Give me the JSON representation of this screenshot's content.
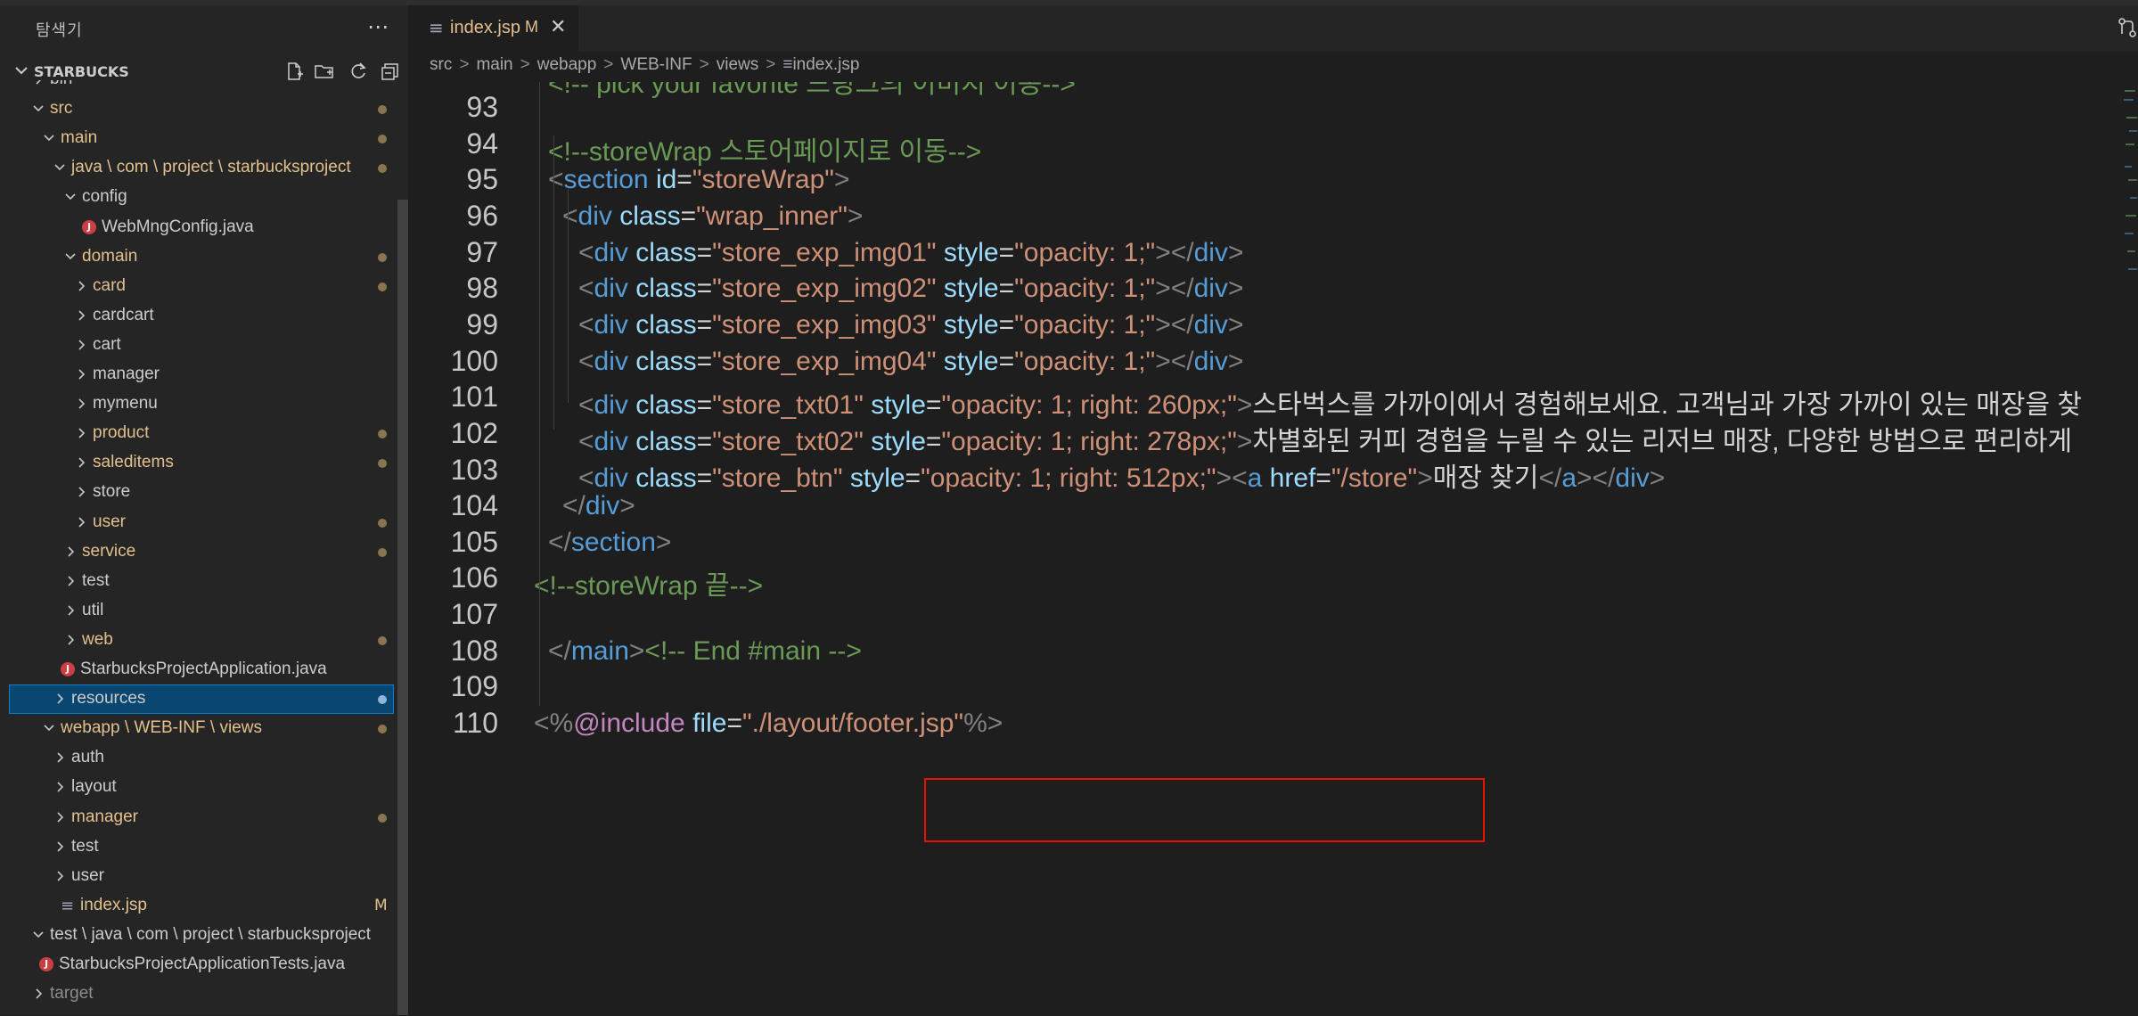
{
  "explorer": {
    "title": "탐색기",
    "more_icon": "ellipsis-icon",
    "workspace": "STARBUCKS",
    "actions": [
      "new-file-icon",
      "new-folder-icon",
      "refresh-icon",
      "collapse-all-icon"
    ]
  },
  "tree": [
    {
      "label": "bin",
      "kind": "folder",
      "expanded": false,
      "color": "default",
      "badge": ""
    },
    {
      "label": "src",
      "kind": "folder",
      "expanded": true,
      "color": "modified",
      "badge": "dot"
    },
    {
      "label": "main",
      "kind": "folder",
      "expanded": true,
      "color": "modified",
      "badge": "dot"
    },
    {
      "label": "java \\ com \\ project \\ starbucksproject",
      "kind": "folder",
      "expanded": true,
      "color": "modified",
      "badge": "dot"
    },
    {
      "label": "config",
      "kind": "folder",
      "expanded": true,
      "color": "default",
      "badge": ""
    },
    {
      "label": "WebMngConfig.java",
      "kind": "java",
      "color": "default",
      "badge": ""
    },
    {
      "label": "domain",
      "kind": "folder",
      "expanded": true,
      "color": "modified",
      "badge": "dot"
    },
    {
      "label": "card",
      "kind": "folder",
      "expanded": false,
      "color": "modified",
      "badge": "dot"
    },
    {
      "label": "cardcart",
      "kind": "folder",
      "expanded": false,
      "color": "default",
      "badge": ""
    },
    {
      "label": "cart",
      "kind": "folder",
      "expanded": false,
      "color": "default",
      "badge": ""
    },
    {
      "label": "manager",
      "kind": "folder",
      "expanded": false,
      "color": "default",
      "badge": ""
    },
    {
      "label": "mymenu",
      "kind": "folder",
      "expanded": false,
      "color": "default",
      "badge": ""
    },
    {
      "label": "product",
      "kind": "folder",
      "expanded": false,
      "color": "modified",
      "badge": "dot"
    },
    {
      "label": "saleditems",
      "kind": "folder",
      "expanded": false,
      "color": "modified",
      "badge": "dot"
    },
    {
      "label": "store",
      "kind": "folder",
      "expanded": false,
      "color": "default",
      "badge": ""
    },
    {
      "label": "user",
      "kind": "folder",
      "expanded": false,
      "color": "modified",
      "badge": "dot"
    },
    {
      "label": "service",
      "kind": "folder",
      "expanded": false,
      "color": "modified",
      "badge": "dot"
    },
    {
      "label": "test",
      "kind": "folder",
      "expanded": false,
      "color": "default",
      "badge": ""
    },
    {
      "label": "util",
      "kind": "folder",
      "expanded": false,
      "color": "default",
      "badge": ""
    },
    {
      "label": "web",
      "kind": "folder",
      "expanded": false,
      "color": "modified",
      "badge": "dot"
    },
    {
      "label": "StarbucksProjectApplication.java",
      "kind": "java",
      "color": "default",
      "badge": ""
    },
    {
      "label": "resources",
      "kind": "folder",
      "expanded": false,
      "color": "default",
      "badge": "dot",
      "selected": true
    },
    {
      "label": "webapp \\ WEB-INF \\ views",
      "kind": "folder",
      "expanded": true,
      "color": "modified",
      "badge": "dot"
    },
    {
      "label": "auth",
      "kind": "folder",
      "expanded": false,
      "color": "default",
      "badge": ""
    },
    {
      "label": "layout",
      "kind": "folder",
      "expanded": false,
      "color": "default",
      "badge": ""
    },
    {
      "label": "manager",
      "kind": "folder",
      "expanded": false,
      "color": "modified",
      "badge": "dot"
    },
    {
      "label": "test",
      "kind": "folder",
      "expanded": false,
      "color": "default",
      "badge": ""
    },
    {
      "label": "user",
      "kind": "folder",
      "expanded": false,
      "color": "default",
      "badge": ""
    },
    {
      "label": "index.jsp",
      "kind": "jsp",
      "color": "modified",
      "badge": "M"
    },
    {
      "label": "test \\ java \\ com \\ project \\ starbucksproject",
      "kind": "folder",
      "expanded": true,
      "color": "default",
      "badge": ""
    },
    {
      "label": "StarbucksProjectApplicationTests.java",
      "kind": "java",
      "color": "default",
      "badge": ""
    },
    {
      "label": "target",
      "kind": "folder",
      "expanded": false,
      "color": "gray",
      "badge": ""
    }
  ],
  "tab": {
    "icon": "file-lines-icon",
    "label": "index.jsp",
    "modified": "M",
    "close_icon": "close-icon"
  },
  "topright_icon": "source-control-icon",
  "breadcrumb": [
    "src",
    "main",
    "webapp",
    "WEB-INF",
    "views",
    "index.jsp"
  ],
  "code": [
    {
      "n": "93",
      "tokens": []
    },
    {
      "n": "94",
      "tokens": [
        [
          "com",
          "<!--storeWrap 스토어페이지로 이동-->"
        ]
      ]
    },
    {
      "n": "95",
      "tokens": [
        [
          "tag",
          "<"
        ],
        [
          "name",
          "section"
        ],
        [
          "eq",
          " "
        ],
        [
          "attr",
          "id"
        ],
        [
          "eq",
          "="
        ],
        [
          "str",
          "\"storeWrap\""
        ],
        [
          "tag",
          ">"
        ]
      ]
    },
    {
      "n": "96",
      "tokens": [
        [
          "tag",
          "<"
        ],
        [
          "name",
          "div"
        ],
        [
          "eq",
          " "
        ],
        [
          "attr",
          "class"
        ],
        [
          "eq",
          "="
        ],
        [
          "str",
          "\"wrap_inner\""
        ],
        [
          "tag",
          ">"
        ]
      ]
    },
    {
      "n": "97",
      "tokens": [
        [
          "tag",
          "<"
        ],
        [
          "name",
          "div"
        ],
        [
          "eq",
          " "
        ],
        [
          "attr",
          "class"
        ],
        [
          "eq",
          "="
        ],
        [
          "str",
          "\"store_exp_img01\""
        ],
        [
          "eq",
          " "
        ],
        [
          "attr",
          "style"
        ],
        [
          "eq",
          "="
        ],
        [
          "str",
          "\"opacity: 1;\""
        ],
        [
          "tag",
          "></"
        ],
        [
          "name",
          "div"
        ],
        [
          "tag",
          ">"
        ]
      ]
    },
    {
      "n": "98",
      "tokens": [
        [
          "tag",
          "<"
        ],
        [
          "name",
          "div"
        ],
        [
          "eq",
          " "
        ],
        [
          "attr",
          "class"
        ],
        [
          "eq",
          "="
        ],
        [
          "str",
          "\"store_exp_img02\""
        ],
        [
          "eq",
          " "
        ],
        [
          "attr",
          "style"
        ],
        [
          "eq",
          "="
        ],
        [
          "str",
          "\"opacity: 1;\""
        ],
        [
          "tag",
          "></"
        ],
        [
          "name",
          "div"
        ],
        [
          "tag",
          ">"
        ]
      ]
    },
    {
      "n": "99",
      "tokens": [
        [
          "tag",
          "<"
        ],
        [
          "name",
          "div"
        ],
        [
          "eq",
          " "
        ],
        [
          "attr",
          "class"
        ],
        [
          "eq",
          "="
        ],
        [
          "str",
          "\"store_exp_img03\""
        ],
        [
          "eq",
          " "
        ],
        [
          "attr",
          "style"
        ],
        [
          "eq",
          "="
        ],
        [
          "str",
          "\"opacity: 1;\""
        ],
        [
          "tag",
          "></"
        ],
        [
          "name",
          "div"
        ],
        [
          "tag",
          ">"
        ]
      ]
    },
    {
      "n": "100",
      "tokens": [
        [
          "tag",
          "<"
        ],
        [
          "name",
          "div"
        ],
        [
          "eq",
          " "
        ],
        [
          "attr",
          "class"
        ],
        [
          "eq",
          "="
        ],
        [
          "str",
          "\"store_exp_img04\""
        ],
        [
          "eq",
          " "
        ],
        [
          "attr",
          "style"
        ],
        [
          "eq",
          "="
        ],
        [
          "str",
          "\"opacity: 1;\""
        ],
        [
          "tag",
          "></"
        ],
        [
          "name",
          "div"
        ],
        [
          "tag",
          ">"
        ]
      ]
    },
    {
      "n": "101",
      "tokens": [
        [
          "tag",
          "<"
        ],
        [
          "name",
          "div"
        ],
        [
          "eq",
          " "
        ],
        [
          "attr",
          "class"
        ],
        [
          "eq",
          "="
        ],
        [
          "str",
          "\"store_txt01\""
        ],
        [
          "eq",
          " "
        ],
        [
          "attr",
          "style"
        ],
        [
          "eq",
          "="
        ],
        [
          "str",
          "\"opacity: 1; right: 260px;\""
        ],
        [
          "tag",
          ">"
        ],
        [
          "text",
          "스타벅스를 가까이에서 경험해보세요. 고객님과 가장 가까이 있는 매장을 찾"
        ]
      ]
    },
    {
      "n": "102",
      "tokens": [
        [
          "tag",
          "<"
        ],
        [
          "name",
          "div"
        ],
        [
          "eq",
          " "
        ],
        [
          "attr",
          "class"
        ],
        [
          "eq",
          "="
        ],
        [
          "str",
          "\"store_txt02\""
        ],
        [
          "eq",
          " "
        ],
        [
          "attr",
          "style"
        ],
        [
          "eq",
          "="
        ],
        [
          "str",
          "\"opacity: 1; right: 278px;\""
        ],
        [
          "tag",
          ">"
        ],
        [
          "text",
          "차별화된 커피 경험을 누릴 수 있는 리저브 매장, 다양한 방법으로 편리하게"
        ]
      ]
    },
    {
      "n": "103",
      "tokens": [
        [
          "tag",
          "<"
        ],
        [
          "name",
          "div"
        ],
        [
          "eq",
          " "
        ],
        [
          "attr",
          "class"
        ],
        [
          "eq",
          "="
        ],
        [
          "str",
          "\"store_btn\""
        ],
        [
          "eq",
          " "
        ],
        [
          "attr",
          "style"
        ],
        [
          "eq",
          "="
        ],
        [
          "str",
          "\"opacity: 1; right: 512px;\""
        ],
        [
          "tag",
          "><"
        ],
        [
          "name",
          "a"
        ],
        [
          "eq",
          " "
        ],
        [
          "attr",
          "href"
        ],
        [
          "eq",
          "="
        ],
        [
          "str",
          "\"/store\""
        ],
        [
          "tag",
          ">"
        ],
        [
          "text",
          "매장 찾기"
        ],
        [
          "tag",
          "</"
        ],
        [
          "name",
          "a"
        ],
        [
          "tag",
          "></"
        ],
        [
          "name",
          "div"
        ],
        [
          "tag",
          ">"
        ]
      ]
    },
    {
      "n": "104",
      "tokens": [
        [
          "tag",
          "</"
        ],
        [
          "name",
          "div"
        ],
        [
          "tag",
          ">"
        ]
      ]
    },
    {
      "n": "105",
      "tokens": [
        [
          "tag",
          "</"
        ],
        [
          "name",
          "section"
        ],
        [
          "tag",
          ">"
        ]
      ]
    },
    {
      "n": "106",
      "tokens": [
        [
          "com",
          "<!--storeWrap 끝-->"
        ]
      ]
    },
    {
      "n": "107",
      "tokens": []
    },
    {
      "n": "108",
      "tokens": [
        [
          "tag",
          "</"
        ],
        [
          "name",
          "main"
        ],
        [
          "tag",
          ">"
        ],
        [
          "com",
          "<!-- End #main -->"
        ]
      ]
    },
    {
      "n": "109",
      "tokens": []
    },
    {
      "n": "110",
      "tokens": [
        [
          "tag",
          "<%"
        ],
        [
          "dir",
          "@"
        ],
        [
          "dir",
          "include"
        ],
        [
          "eq",
          " "
        ],
        [
          "attr",
          "file"
        ],
        [
          "eq",
          "="
        ],
        [
          "str",
          "\"./layout/footer.jsp\""
        ],
        [
          "tag",
          "%>"
        ]
      ]
    }
  ],
  "partial_top_line": "<!-- pick your favorite 드링크의 이미지 이동-->"
}
